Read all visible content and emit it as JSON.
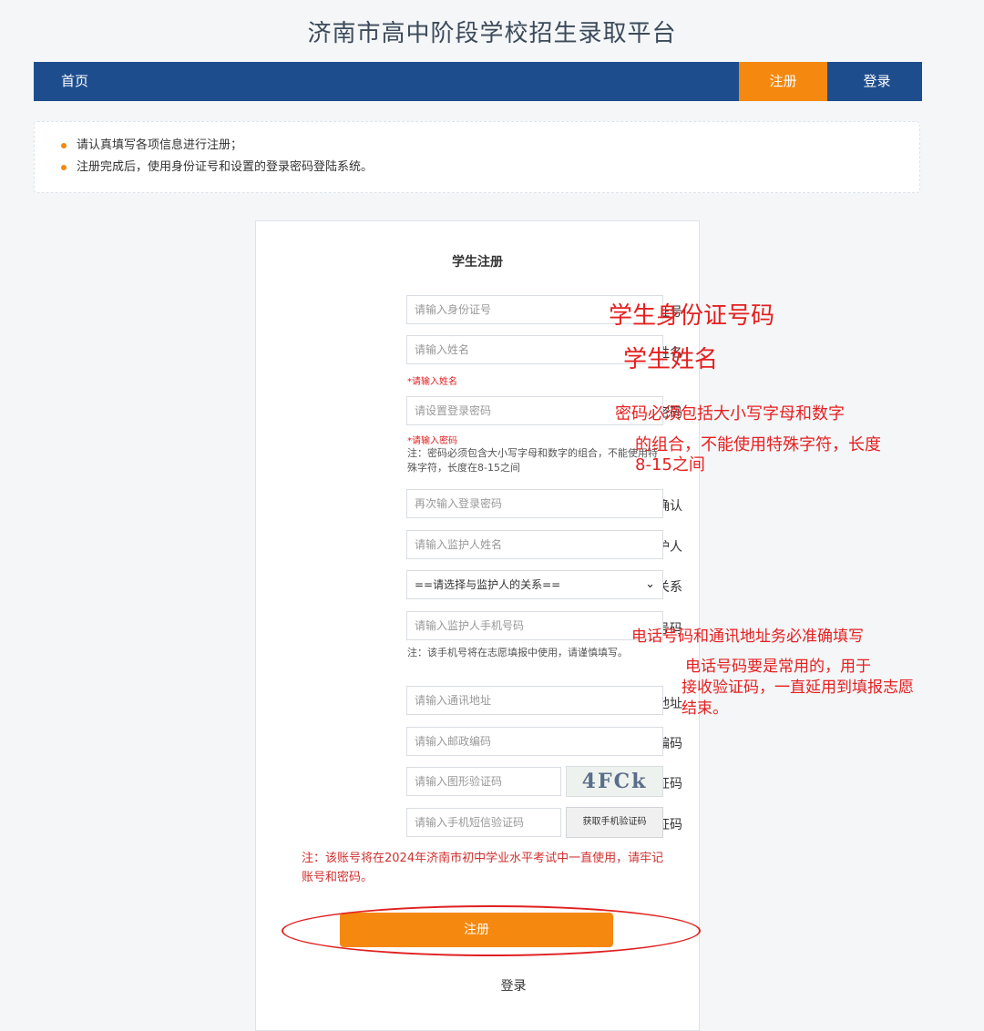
{
  "site": {
    "title": "济南市高中阶段学校招生录取平台"
  },
  "nav": {
    "home": "首页",
    "register": "注册",
    "login": "登录",
    "accent_color": "#f5880f",
    "bar_color": "#1e4d8e"
  },
  "notice": {
    "items": [
      "请认真填写各项信息进行注册；",
      "注册完成后，使用身份证号和设置的登录密码登陆系统。"
    ]
  },
  "form": {
    "title": "学生注册",
    "id_label": "身份证号",
    "id_placeholder": "请输入身份证号",
    "name_label": "姓名",
    "name_placeholder": "请输入姓名",
    "name_error": "*请输入姓名",
    "pwd_label": "设置登录密码",
    "pwd_placeholder": "请设置登录密码",
    "pwd_error": "*请输入密码",
    "pwd_note": "注：密码必须包含大小写字母和数字的组合，不能使用特殊字符，长度在8-15之间",
    "confirm_label": "密码确认",
    "confirm_placeholder": "再次输入登录密码",
    "guardian_label": "监护人",
    "guardian_placeholder": "请输入监护人姓名",
    "relation_label": "监护人与本人关系",
    "relation_selected": "==请选择与监护人的关系==",
    "phone_label": "监护人手机号码",
    "phone_placeholder": "请输入监护人手机号码",
    "phone_note": "注：该手机号将在志愿填报中使用，请谨慎填写。",
    "address_label": "通讯地址",
    "address_placeholder": "请输入通讯地址",
    "postcode_label": "邮政编码",
    "postcode_placeholder": "请输入邮政编码",
    "captcha_label": "图形验证码",
    "captcha_placeholder": "请输入图形验证码",
    "captcha_text": "4FCk",
    "sms_label": "手机验证码",
    "sms_placeholder": "请输入手机短信验证码",
    "sms_button": "获取手机验证码",
    "warning": "注：该账号将在2024年济南市初中学业水平考试中一直使用，请牢记账号和密码。",
    "submit": "注册",
    "login_link": "登录"
  },
  "annotations": {
    "id": "学生身份证号码",
    "name": "学生姓名",
    "pwd_line1": "密码必须包括大小写字母和数字",
    "pwd_line2": "的组合，不能使用特殊字符，长度",
    "pwd_line3": "8-15之间",
    "phone_line1": "电话号码和通讯地址务必准确填写",
    "phone_line2": "电话号码要是常用的，用于",
    "phone_line3": "接收验证码，一直延用到填报志愿",
    "phone_line4": "结束。",
    "color": "#e52020"
  }
}
